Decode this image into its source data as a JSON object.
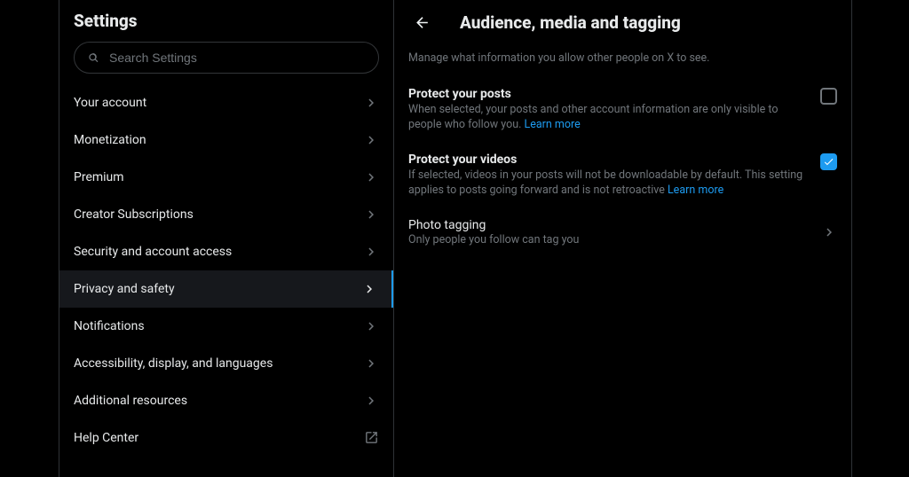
{
  "left": {
    "title": "Settings",
    "search_placeholder": "Search Settings",
    "items": [
      {
        "label": "Your account"
      },
      {
        "label": "Monetization"
      },
      {
        "label": "Premium"
      },
      {
        "label": "Creator Subscriptions"
      },
      {
        "label": "Security and account access"
      },
      {
        "label": "Privacy and safety"
      },
      {
        "label": "Notifications"
      },
      {
        "label": "Accessibility, display, and languages"
      },
      {
        "label": "Additional resources"
      },
      {
        "label": "Help Center"
      }
    ]
  },
  "right": {
    "title": "Audience, media and tagging",
    "subtitle": "Manage what information you allow other people on X to see.",
    "protect_posts": {
      "title": "Protect your posts",
      "desc": "When selected, your posts and other account information are only visible to people who follow you. ",
      "learn_more": "Learn more"
    },
    "protect_videos": {
      "title": "Protect your videos",
      "desc": "If selected, videos in your posts will not be downloadable by default. This setting applies to posts going forward and is not retroactive ",
      "learn_more": "Learn more"
    },
    "photo_tagging": {
      "title": "Photo tagging",
      "sub": "Only people you follow can tag you"
    }
  }
}
